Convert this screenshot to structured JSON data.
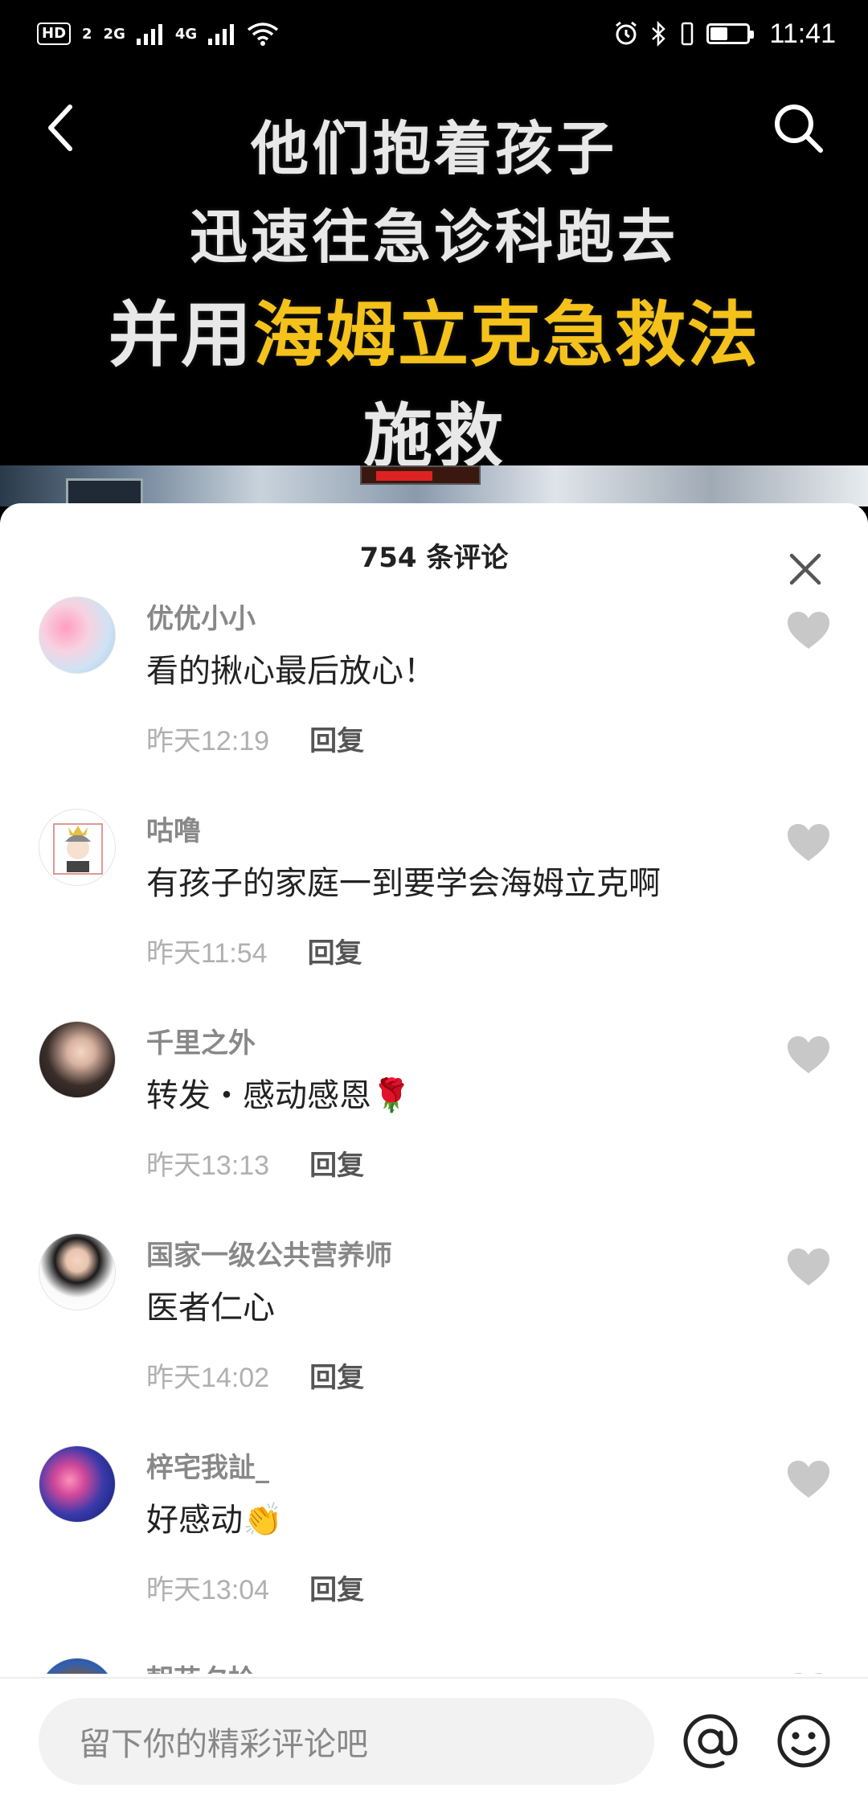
{
  "status_bar": {
    "hd_label": "HD",
    "sim_index": "2",
    "network_1": "2G",
    "network_2": "4G",
    "wifi_sub": "",
    "time": "11:41",
    "battery_level": 0.45,
    "icons": [
      "hd-icon",
      "signal-icon",
      "signal-icon",
      "wifi-icon",
      "alarm-icon",
      "bluetooth-icon",
      "vibrate-icon",
      "battery-icon"
    ]
  },
  "video": {
    "caption_line1": "他们抱着孩子",
    "caption_line2": "迅速往急诊科跑去",
    "caption_line3_a": "并用",
    "caption_line3_b": "海姆立克急救法",
    "caption_line4": "施救",
    "highlight_color": "#f4c21a",
    "back_icon": "back-arrow-icon",
    "search_icon": "search-icon"
  },
  "comments_sheet": {
    "title": "754 条评论",
    "close_icon": "close-icon",
    "reply_label": "回复",
    "items": [
      {
        "user": "优优小小",
        "text": "看的揪心最后放心！",
        "time": "昨天12:19"
      },
      {
        "user": "咕噜",
        "text": "有孩子的家庭一到要学会海姆立克啊",
        "time": "昨天11:54"
      },
      {
        "user": "千里之外",
        "text": "转发・感动感恩🌹",
        "time": "昨天13:13"
      },
      {
        "user": "国家一级公共营养师",
        "text": "医者仁心",
        "time": "昨天14:02"
      },
      {
        "user": "梓宅我訨_",
        "text": "好感动👏",
        "time": "昨天13:04"
      },
      {
        "user": "朝花夕拾",
        "text": "",
        "time": ""
      }
    ]
  },
  "input_bar": {
    "placeholder": "留下你的精彩评论吧",
    "at_icon": "at-icon",
    "emoji_icon": "emoji-icon"
  }
}
